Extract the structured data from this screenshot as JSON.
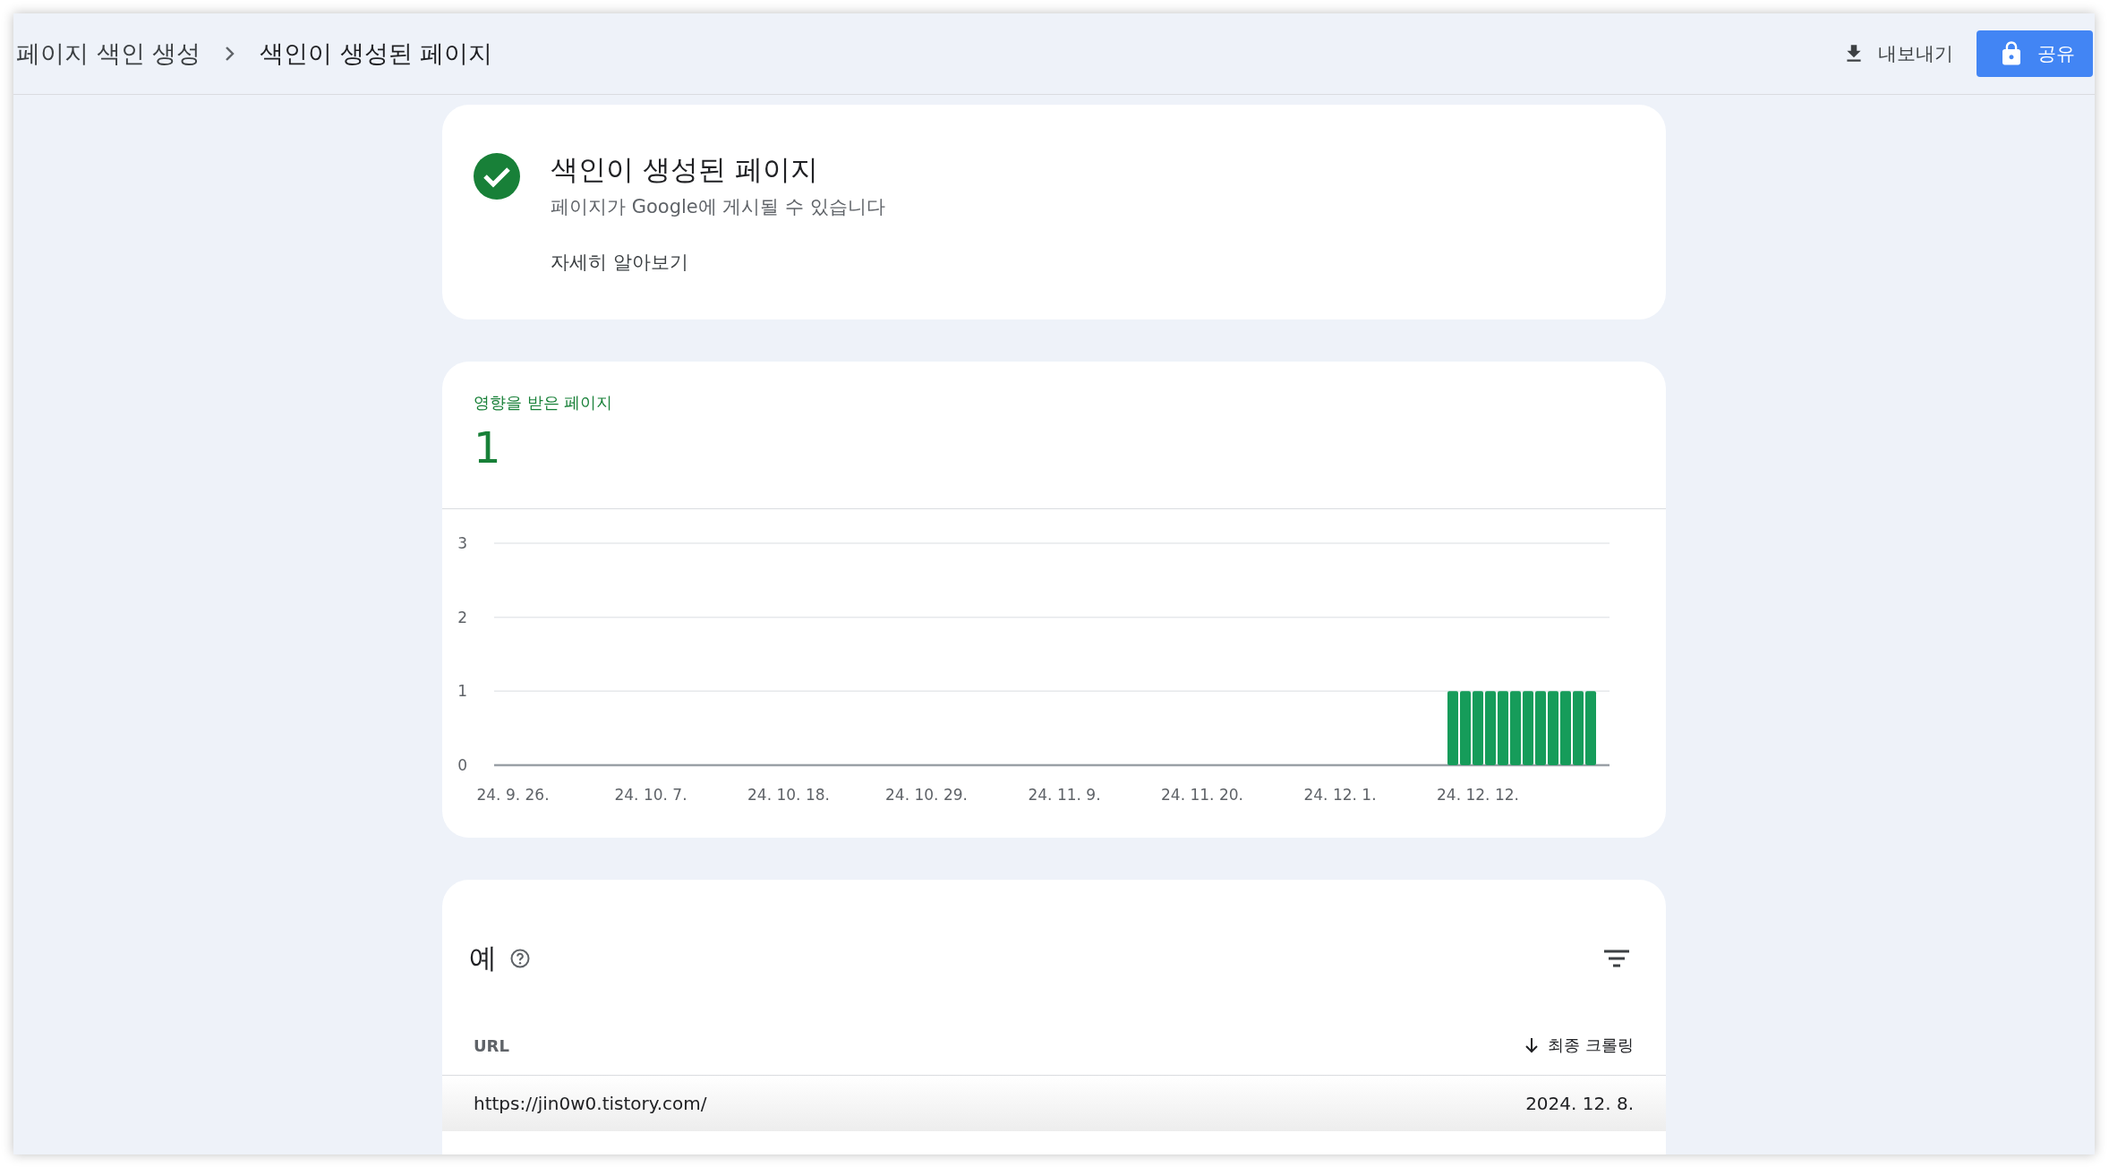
{
  "breadcrumb": [
    {
      "label": "페이지 색인 생성"
    },
    {
      "label": "색인이 생성된 페이지"
    }
  ],
  "toolbar": {
    "export_button": "내보내기",
    "share_button": "공유"
  },
  "status_card": {
    "title": "색인이 생성된 페이지",
    "subtitle": "페이지가 Google에 게시될 수 있습니다",
    "link": "자세히 알아보기"
  },
  "affected_card": {
    "label": "영향을 받은 페이지",
    "count": "1",
    "chart_data": {
      "type": "bar",
      "categories": [
        null,
        "24. 9. 26.",
        null,
        null,
        null,
        null,
        null,
        null,
        null,
        null,
        null,
        null,
        "24. 10. 7.",
        null,
        null,
        null,
        null,
        null,
        null,
        null,
        null,
        null,
        null,
        "24. 10. 18.",
        null,
        null,
        null,
        null,
        null,
        null,
        null,
        null,
        null,
        null,
        "24. 10. 29.",
        null,
        null,
        null,
        null,
        null,
        null,
        null,
        null,
        null,
        null,
        "24. 11. 9.",
        null,
        null,
        null,
        null,
        null,
        null,
        null,
        null,
        null,
        null,
        "24. 11. 20.",
        null,
        null,
        null,
        null,
        null,
        null,
        null,
        null,
        null,
        null,
        "24. 12. 1.",
        null,
        null,
        null,
        null,
        null,
        null,
        null,
        null,
        null,
        null,
        "24. 12. 12.",
        null,
        null,
        null,
        null,
        null,
        null,
        null,
        null,
        null,
        null
      ],
      "values": [
        0,
        0,
        0,
        0,
        0,
        0,
        0,
        0,
        0,
        0,
        0,
        0,
        0,
        0,
        0,
        0,
        0,
        0,
        0,
        0,
        0,
        0,
        0,
        0,
        0,
        0,
        0,
        0,
        0,
        0,
        0,
        0,
        0,
        0,
        0,
        0,
        0,
        0,
        0,
        0,
        0,
        0,
        0,
        0,
        0,
        0,
        0,
        0,
        0,
        0,
        0,
        0,
        0,
        0,
        0,
        0,
        0,
        0,
        0,
        0,
        0,
        0,
        0,
        0,
        0,
        0,
        0,
        0,
        0,
        0,
        0,
        0,
        0,
        0,
        0,
        0,
        1,
        1,
        1,
        1,
        1,
        1,
        1,
        1,
        1,
        1,
        1,
        1,
        0
      ],
      "ylim": [
        0,
        3
      ],
      "yticks": [
        0,
        1,
        2,
        3
      ]
    }
  },
  "examples": {
    "title": "예",
    "columns": [
      {
        "label": "URL",
        "sorted": false
      },
      {
        "label": "최종 크롤링",
        "sorted": true
      }
    ],
    "rows": [
      [
        "https://jin0w0.tistory.com/",
        "2024. 12. 8."
      ]
    ]
  }
}
